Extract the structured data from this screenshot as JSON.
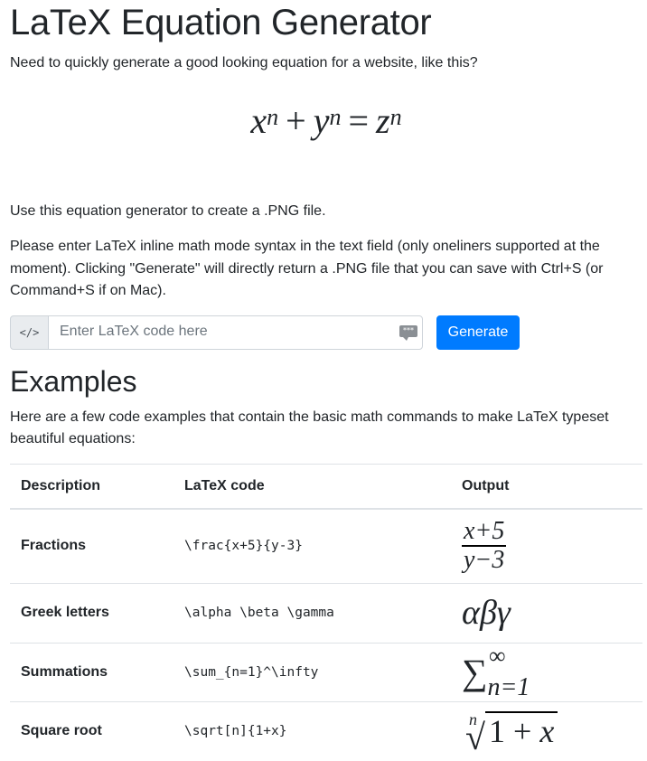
{
  "page": {
    "title": "LaTeX Equation Generator",
    "intro": "Need to quickly generate a good looking equation for a website, like this?",
    "use_text": "Use this equation generator to create a .PNG file.",
    "instructions": "Please enter LaTeX inline math mode syntax in the text field (only oneliners supported at the moment). Clicking \"Generate\" will directly return a .PNG file that you can save with Ctrl+S (or Command+S if on Mac)."
  },
  "hero_equation": {
    "x": "x",
    "y": "y",
    "z": "z",
    "exp": "n",
    "plus": "+",
    "equals": "="
  },
  "form": {
    "addon_label": "</>",
    "placeholder": "Enter LaTeX code here",
    "value": "",
    "keyboard_icon_text": "***",
    "generate_label": "Generate"
  },
  "examples": {
    "heading": "Examples",
    "intro": "Here are a few code examples that contain the basic math commands to make LaTeX typeset beautiful equations:",
    "columns": [
      "Description",
      "LaTeX code",
      "Output"
    ],
    "rows": [
      {
        "description": "Fractions",
        "code": "\\frac{x+5}{y-3}",
        "out_num": "x+5",
        "out_den": "y−3"
      },
      {
        "description": "Greek letters",
        "code": "\\alpha \\beta \\gamma",
        "out": "αβγ"
      },
      {
        "description": "Summations",
        "code": "\\sum_{n=1}^\\infty",
        "out_sym": "∑",
        "out_sup": "∞",
        "out_sub": "n=1"
      },
      {
        "description": "Square root",
        "code": "\\sqrt[n]{1+x}",
        "out_idx": "n",
        "out_rad": "√",
        "out_body_a": "1 + ",
        "out_body_b": "x"
      }
    ]
  },
  "colors": {
    "primary": "#007bff",
    "addon_bg": "#e9ecef",
    "border": "#dee2e6",
    "text": "#212529"
  }
}
